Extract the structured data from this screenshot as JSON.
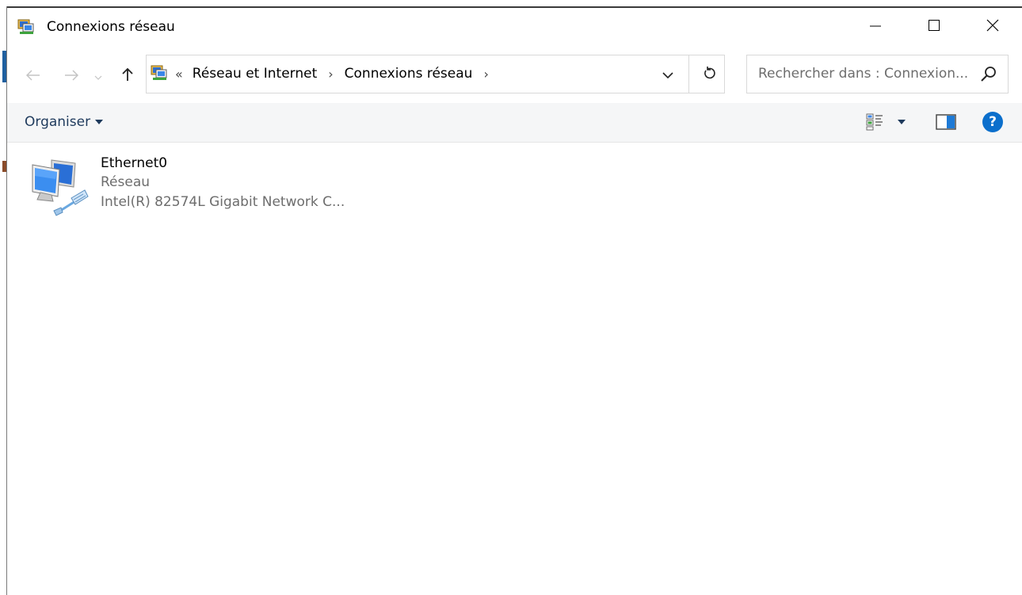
{
  "window": {
    "title": "Connexions réseau",
    "icon": "network-connections-icon"
  },
  "caption_buttons": {
    "minimize_icon": "minimize-icon",
    "maximize_icon": "maximize-icon",
    "close_icon": "close-icon"
  },
  "navigation": {
    "back_icon": "arrow-left-icon",
    "forward_icon": "arrow-right-icon",
    "recent_icon": "chevron-down-icon",
    "up_icon": "arrow-up-icon"
  },
  "address_bar": {
    "overflow": "«",
    "crumbs": [
      "Réseau et Internet",
      "Connexions réseau"
    ],
    "separator": "›",
    "dropdown_icon": "chevron-down-icon",
    "refresh_icon": "refresh-icon"
  },
  "search": {
    "placeholder": "Rechercher dans : Connexion...",
    "icon": "search-icon"
  },
  "command_bar": {
    "organise_label": "Organiser",
    "view_icon": "view-options-icon",
    "preview_icon": "preview-pane-icon",
    "help_label": "?"
  },
  "items": [
    {
      "name": "Ethernet0",
      "status": "Réseau",
      "device": "Intel(R) 82574L Gigabit Network C...",
      "icon": "ethernet-adapter-icon"
    }
  ],
  "colors": {
    "accent_blue": "#0b6fcc",
    "command_bar_bg": "#f5f6f7",
    "secondary_text": "#6d6d6d",
    "organise_text": "#1e3a5c"
  }
}
